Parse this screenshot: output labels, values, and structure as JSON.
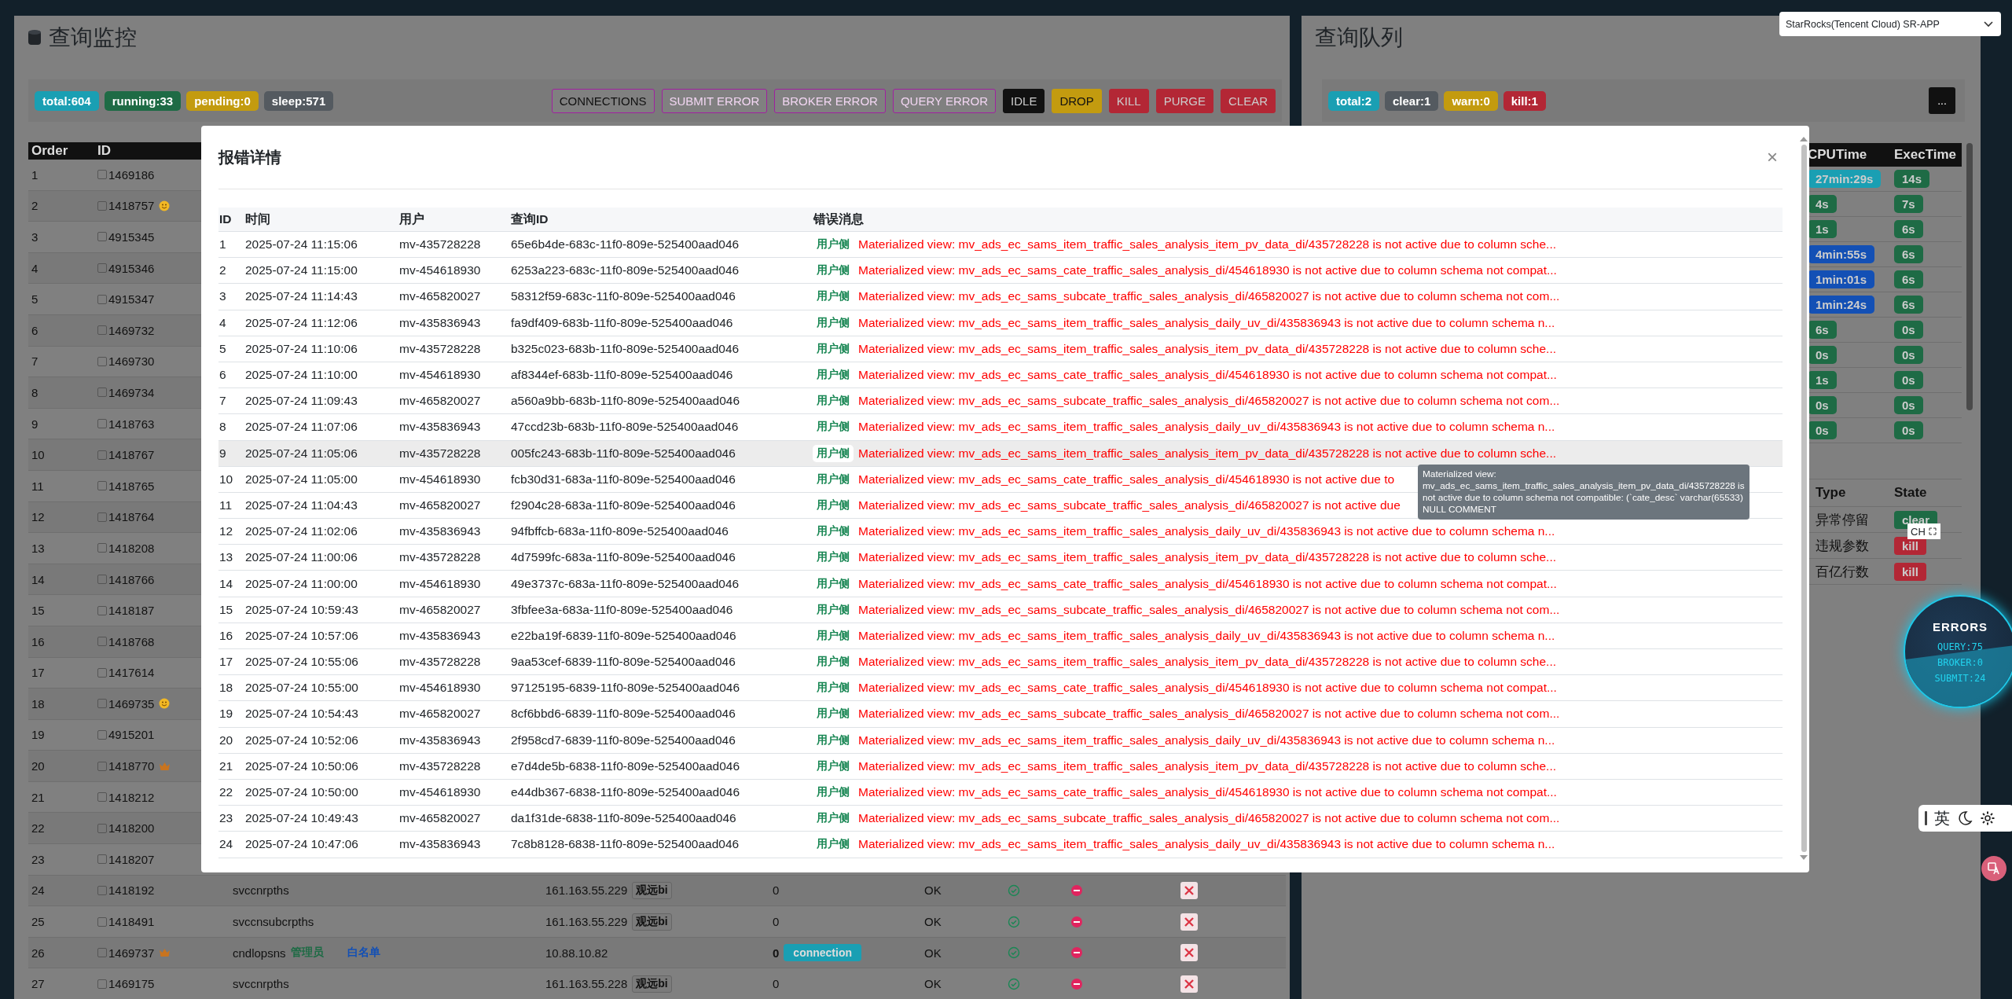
{
  "app_selector": {
    "value": "StarRocks(Tencent Cloud) SR-APP"
  },
  "monitor": {
    "title": "查询监控",
    "stats": [
      {
        "label": "total:604",
        "color": "#1a9fb3"
      },
      {
        "label": "running:33",
        "color": "#1e6b45"
      },
      {
        "label": "pending:0",
        "color": "#c39b0f"
      },
      {
        "label": "sleep:571",
        "color": "#545a60"
      }
    ],
    "actions": [
      {
        "label": "CONNECTIONS",
        "kind": "outline",
        "color": "#a020a0",
        "disabled": false
      },
      {
        "label": "SUBMIT ERROR",
        "kind": "outline",
        "color": "#a020a0",
        "disabled": true
      },
      {
        "label": "BROKER ERROR",
        "kind": "outline",
        "color": "#a020a0",
        "disabled": true
      },
      {
        "label": "QUERY ERROR",
        "kind": "outline",
        "color": "#a020a0",
        "disabled": true
      },
      {
        "label": "IDLE",
        "kind": "solid",
        "color": "#111111",
        "disabled": false
      },
      {
        "label": "DROP",
        "kind": "solid",
        "color": "#c39b0f",
        "disabled": false
      },
      {
        "label": "KILL",
        "kind": "solid",
        "color": "#b32735",
        "disabled": false
      },
      {
        "label": "PURGE",
        "kind": "solid",
        "color": "#b32735",
        "disabled": false
      },
      {
        "label": "CLEAR",
        "kind": "solid",
        "color": "#b32735",
        "disabled": false
      }
    ],
    "table": {
      "columns": [
        "Order",
        "ID"
      ],
      "rows": [
        {
          "order": "1",
          "id": "1469186",
          "checked": false,
          "kind": "plain"
        },
        {
          "order": "2",
          "id": "1418757",
          "checked": false,
          "kind": "smiley"
        },
        {
          "order": "3",
          "id": "4915345",
          "checked": false,
          "kind": "plain"
        },
        {
          "order": "4",
          "id": "4915346",
          "checked": false,
          "kind": "plain"
        },
        {
          "order": "5",
          "id": "4915347",
          "checked": false,
          "kind": "plain"
        },
        {
          "order": "6",
          "id": "1469732",
          "checked": false,
          "kind": "plain"
        },
        {
          "order": "7",
          "id": "1469730",
          "checked": false,
          "kind": "plain"
        },
        {
          "order": "8",
          "id": "1469734",
          "checked": false,
          "kind": "plain"
        },
        {
          "order": "9",
          "id": "1418763",
          "checked": false,
          "kind": "plain"
        },
        {
          "order": "10",
          "id": "1418767",
          "checked": false,
          "kind": "plain"
        },
        {
          "order": "11",
          "id": "1418765",
          "checked": false,
          "kind": "plain"
        },
        {
          "order": "12",
          "id": "1418764",
          "checked": false,
          "kind": "plain"
        },
        {
          "order": "13",
          "id": "1418208",
          "checked": false,
          "kind": "plain"
        },
        {
          "order": "14",
          "id": "1418766",
          "checked": false,
          "kind": "plain"
        },
        {
          "order": "15",
          "id": "1418187",
          "checked": false,
          "kind": "plain"
        },
        {
          "order": "16",
          "id": "1418768",
          "checked": false,
          "kind": "plain"
        },
        {
          "order": "17",
          "id": "1417614",
          "checked": false,
          "kind": "plain"
        },
        {
          "order": "18",
          "id": "1469735",
          "checked": false,
          "kind": "smiley"
        },
        {
          "order": "19",
          "id": "4915201",
          "checked": false,
          "kind": "plain"
        },
        {
          "order": "20",
          "id": "1418770",
          "checked": false,
          "kind": "crown"
        },
        {
          "order": "21",
          "id": "1418212",
          "checked": false,
          "kind": "plain"
        },
        {
          "order": "22",
          "id": "1418200",
          "checked": false,
          "kind": "plain"
        },
        {
          "order": "23",
          "id": "1418207",
          "checked": false,
          "kind": "plain"
        },
        {
          "order": "24",
          "id": "1418192",
          "checked": false,
          "kind": "plain",
          "user": "svccnrpths",
          "ip": "161.163.55.229",
          "tag": "观远bi",
          "count": "0",
          "count_emphasized": false,
          "status": "OK"
        },
        {
          "order": "25",
          "id": "1418491",
          "checked": false,
          "kind": "plain",
          "user": "svccnsubcrpths",
          "ip": "161.163.55.229",
          "tag": "观远bi",
          "count": "0",
          "count_emphasized": false,
          "status": "OK"
        },
        {
          "order": "26",
          "id": "1469737",
          "checked": false,
          "kind": "crown",
          "user": "cndlopsns",
          "roles": [
            {
              "label": "管理员",
              "color": "#1e6b45"
            },
            {
              "label": "白名单",
              "color": "#1350b5"
            }
          ],
          "ip": "10.88.10.82",
          "count": "0",
          "count_emphasized": true,
          "connection": "connection",
          "status": "OK"
        },
        {
          "order": "27",
          "id": "1469175",
          "checked": false,
          "kind": "plain",
          "user": "svccnrpths",
          "ip": "161.163.55.228",
          "tag": "观远bi",
          "count": "0",
          "count_emphasized": false,
          "status": "OK"
        }
      ]
    }
  },
  "queue": {
    "title": "查询队列",
    "stats": [
      {
        "label": "total:2",
        "color": "#1a9fb3"
      },
      {
        "label": "clear:1",
        "color": "#545a60"
      },
      {
        "label": "warn:0",
        "color": "#c39b0f"
      },
      {
        "label": "kill:1",
        "color": "#b32735"
      }
    ],
    "more_button": "...",
    "table": {
      "columns": [
        "CPUTime",
        "ExecTime"
      ],
      "rows": [
        {
          "cpu": {
            "text": "27min:29s",
            "color": "#1a9fb3"
          },
          "exec": {
            "text": "14s",
            "color": "#1e6b45"
          }
        },
        {
          "cpu": {
            "text": "4s",
            "color": "#1e6b45"
          },
          "exec": {
            "text": "7s",
            "color": "#1e6b45"
          }
        },
        {
          "cpu": {
            "text": "1s",
            "color": "#1e6b45"
          },
          "exec": {
            "text": "6s",
            "color": "#1e6b45"
          }
        },
        {
          "cpu": {
            "text": "4min:55s",
            "color": "#1350b5"
          },
          "exec": {
            "text": "6s",
            "color": "#1e6b45"
          }
        },
        {
          "cpu": {
            "text": "1min:01s",
            "color": "#1350b5"
          },
          "exec": {
            "text": "6s",
            "color": "#1e6b45"
          }
        },
        {
          "cpu": {
            "text": "1min:24s",
            "color": "#1350b5"
          },
          "exec": {
            "text": "6s",
            "color": "#1e6b45"
          }
        },
        {
          "cpu": {
            "text": "6s",
            "color": "#1e6b45"
          },
          "exec": {
            "text": "0s",
            "color": "#1e6b45"
          }
        },
        {
          "cpu": {
            "text": "0s",
            "color": "#1e6b45"
          },
          "exec": {
            "text": "0s",
            "color": "#1e6b45"
          }
        },
        {
          "cpu": {
            "text": "1s",
            "color": "#1e6b45"
          },
          "exec": {
            "text": "0s",
            "color": "#1e6b45"
          }
        },
        {
          "cpu": {
            "text": "0s",
            "color": "#1e6b45"
          },
          "exec": {
            "text": "0s",
            "color": "#1e6b45"
          }
        },
        {
          "cpu": {
            "text": "0s",
            "color": "#1e6b45"
          },
          "exec": {
            "text": "0s",
            "color": "#1e6b45"
          }
        }
      ]
    },
    "rules": {
      "columns": [
        "Type",
        "State"
      ],
      "rows": [
        {
          "type": "异常停留",
          "state": "clear",
          "color": "#1e6b45"
        },
        {
          "type": "违规参数",
          "state": "kill",
          "color": "#b32735"
        },
        {
          "type": "百亿行数",
          "state": "kill",
          "color": "#b32735"
        }
      ]
    }
  },
  "error_dialog": {
    "title": "报错详情",
    "close": "×",
    "columns": [
      "ID",
      "时间",
      "用户",
      "查询ID",
      "错误消息"
    ],
    "rows": [
      {
        "id": "1",
        "time": "2025-07-24 11:15:06",
        "user": "mv-435728228",
        "query_id": "65e6b4de-683c-11f0-809e-525400aad046",
        "side": "用户侧",
        "message": "Materialized view: mv_ads_ec_sams_item_traffic_sales_analysis_item_pv_data_di/435728228 is not active due to column sche...",
        "highlighted": false
      },
      {
        "id": "2",
        "time": "2025-07-24 11:15:00",
        "user": "mv-454618930",
        "query_id": "6253a223-683c-11f0-809e-525400aad046",
        "side": "用户侧",
        "message": "Materialized view: mv_ads_ec_sams_cate_traffic_sales_analysis_di/454618930 is not active due to column schema not compat...",
        "highlighted": false
      },
      {
        "id": "3",
        "time": "2025-07-24 11:14:43",
        "user": "mv-465820027",
        "query_id": "58312f59-683c-11f0-809e-525400aad046",
        "side": "用户侧",
        "message": "Materialized view: mv_ads_ec_sams_subcate_traffic_sales_analysis_di/465820027 is not active due to column schema not com...",
        "highlighted": false
      },
      {
        "id": "4",
        "time": "2025-07-24 11:12:06",
        "user": "mv-435836943",
        "query_id": "fa9df409-683b-11f0-809e-525400aad046",
        "side": "用户侧",
        "message": "Materialized view: mv_ads_ec_sams_item_traffic_sales_analysis_daily_uv_di/435836943 is not active due to column schema n...",
        "highlighted": false
      },
      {
        "id": "5",
        "time": "2025-07-24 11:10:06",
        "user": "mv-435728228",
        "query_id": "b325c023-683b-11f0-809e-525400aad046",
        "side": "用户侧",
        "message": "Materialized view: mv_ads_ec_sams_item_traffic_sales_analysis_item_pv_data_di/435728228 is not active due to column sche...",
        "highlighted": false
      },
      {
        "id": "6",
        "time": "2025-07-24 11:10:00",
        "user": "mv-454618930",
        "query_id": "af8344ef-683b-11f0-809e-525400aad046",
        "side": "用户侧",
        "message": "Materialized view: mv_ads_ec_sams_cate_traffic_sales_analysis_di/454618930 is not active due to column schema not compat...",
        "highlighted": false
      },
      {
        "id": "7",
        "time": "2025-07-24 11:09:43",
        "user": "mv-465820027",
        "query_id": "a560a9bb-683b-11f0-809e-525400aad046",
        "side": "用户侧",
        "message": "Materialized view: mv_ads_ec_sams_subcate_traffic_sales_analysis_di/465820027 is not active due to column schema not com...",
        "highlighted": false
      },
      {
        "id": "8",
        "time": "2025-07-24 11:07:06",
        "user": "mv-435836943",
        "query_id": "47ccd23b-683b-11f0-809e-525400aad046",
        "side": "用户侧",
        "message": "Materialized view: mv_ads_ec_sams_item_traffic_sales_analysis_daily_uv_di/435836943 is not active due to column schema n...",
        "highlighted": false
      },
      {
        "id": "9",
        "time": "2025-07-24 11:05:06",
        "user": "mv-435728228",
        "query_id": "005fc243-683b-11f0-809e-525400aad046",
        "side": "用户侧",
        "message": "Materialized view: mv_ads_ec_sams_item_traffic_sales_analysis_item_pv_data_di/435728228 is not active due to column sche...",
        "highlighted": true
      },
      {
        "id": "10",
        "time": "2025-07-24 11:05:00",
        "user": "mv-454618930",
        "query_id": "fcb30d31-683a-11f0-809e-525400aad046",
        "side": "用户侧",
        "message": "Materialized view: mv_ads_ec_sams_cate_traffic_sales_analysis_di/454618930 is not active due to",
        "highlighted": false
      },
      {
        "id": "11",
        "time": "2025-07-24 11:04:43",
        "user": "mv-465820027",
        "query_id": "f2904c28-683a-11f0-809e-525400aad046",
        "side": "用户侧",
        "message": "Materialized view: mv_ads_ec_sams_subcate_traffic_sales_analysis_di/465820027 is not active due",
        "highlighted": false
      },
      {
        "id": "12",
        "time": "2025-07-24 11:02:06",
        "user": "mv-435836943",
        "query_id": "94fbffcb-683a-11f0-809e-525400aad046",
        "side": "用户侧",
        "message": "Materialized view: mv_ads_ec_sams_item_traffic_sales_analysis_daily_uv_di/435836943 is not active due to column schema n...",
        "highlighted": false
      },
      {
        "id": "13",
        "time": "2025-07-24 11:00:06",
        "user": "mv-435728228",
        "query_id": "4d7599fc-683a-11f0-809e-525400aad046",
        "side": "用户侧",
        "message": "Materialized view: mv_ads_ec_sams_item_traffic_sales_analysis_item_pv_data_di/435728228 is not active due to column sche...",
        "highlighted": false
      },
      {
        "id": "14",
        "time": "2025-07-24 11:00:00",
        "user": "mv-454618930",
        "query_id": "49e3737c-683a-11f0-809e-525400aad046",
        "side": "用户侧",
        "message": "Materialized view: mv_ads_ec_sams_cate_traffic_sales_analysis_di/454618930 is not active due to column schema not compat...",
        "highlighted": false
      },
      {
        "id": "15",
        "time": "2025-07-24 10:59:43",
        "user": "mv-465820027",
        "query_id": "3fbfee3a-683a-11f0-809e-525400aad046",
        "side": "用户侧",
        "message": "Materialized view: mv_ads_ec_sams_subcate_traffic_sales_analysis_di/465820027 is not active due to column schema not com...",
        "highlighted": false
      },
      {
        "id": "16",
        "time": "2025-07-24 10:57:06",
        "user": "mv-435836943",
        "query_id": "e22ba19f-6839-11f0-809e-525400aad046",
        "side": "用户侧",
        "message": "Materialized view: mv_ads_ec_sams_item_traffic_sales_analysis_daily_uv_di/435836943 is not active due to column schema n...",
        "highlighted": false
      },
      {
        "id": "17",
        "time": "2025-07-24 10:55:06",
        "user": "mv-435728228",
        "query_id": "9aa53cef-6839-11f0-809e-525400aad046",
        "side": "用户侧",
        "message": "Materialized view: mv_ads_ec_sams_item_traffic_sales_analysis_item_pv_data_di/435728228 is not active due to column sche...",
        "highlighted": false
      },
      {
        "id": "18",
        "time": "2025-07-24 10:55:00",
        "user": "mv-454618930",
        "query_id": "97125195-6839-11f0-809e-525400aad046",
        "side": "用户侧",
        "message": "Materialized view: mv_ads_ec_sams_cate_traffic_sales_analysis_di/454618930 is not active due to column schema not compat...",
        "highlighted": false
      },
      {
        "id": "19",
        "time": "2025-07-24 10:54:43",
        "user": "mv-465820027",
        "query_id": "8cf6bbd6-6839-11f0-809e-525400aad046",
        "side": "用户侧",
        "message": "Materialized view: mv_ads_ec_sams_subcate_traffic_sales_analysis_di/465820027 is not active due to column schema not com...",
        "highlighted": false
      },
      {
        "id": "20",
        "time": "2025-07-24 10:52:06",
        "user": "mv-435836943",
        "query_id": "2f958cd7-6839-11f0-809e-525400aad046",
        "side": "用户侧",
        "message": "Materialized view: mv_ads_ec_sams_item_traffic_sales_analysis_daily_uv_di/435836943 is not active due to column schema n...",
        "highlighted": false
      },
      {
        "id": "21",
        "time": "2025-07-24 10:50:06",
        "user": "mv-435728228",
        "query_id": "e7d4de5b-6838-11f0-809e-525400aad046",
        "side": "用户侧",
        "message": "Materialized view: mv_ads_ec_sams_item_traffic_sales_analysis_item_pv_data_di/435728228 is not active due to column sche...",
        "highlighted": false
      },
      {
        "id": "22",
        "time": "2025-07-24 10:50:00",
        "user": "mv-454618930",
        "query_id": "e44db367-6838-11f0-809e-525400aad046",
        "side": "用户侧",
        "message": "Materialized view: mv_ads_ec_sams_cate_traffic_sales_analysis_di/454618930 is not active due to column schema not compat...",
        "highlighted": false
      },
      {
        "id": "23",
        "time": "2025-07-24 10:49:43",
        "user": "mv-465820027",
        "query_id": "da1f31de-6838-11f0-809e-525400aad046",
        "side": "用户侧",
        "message": "Materialized view: mv_ads_ec_sams_subcate_traffic_sales_analysis_di/465820027 is not active due to column schema not com...",
        "highlighted": false
      },
      {
        "id": "24",
        "time": "2025-07-24 10:47:06",
        "user": "mv-435836943",
        "query_id": "7c8b8128-6838-11f0-809e-525400aad046",
        "side": "用户侧",
        "message": "Materialized view: mv_ads_ec_sams_item_traffic_sales_analysis_daily_uv_di/435836943 is not active due to column schema n...",
        "highlighted": false
      }
    ],
    "tooltip": "Materialized view: mv_ads_ec_sams_item_traffic_sales_analysis_item_pv_data_di/435728228 is not active due to column schema not compatible: (`cate_desc` varchar(65533) NULL COMMENT"
  },
  "errors_widget": {
    "title": "ERRORS",
    "lines": [
      "QUERY:75",
      "BROKER:0",
      "SUBMIT:24"
    ]
  },
  "ime_indicator": "CH",
  "ime_bar": {
    "mode": "英"
  }
}
